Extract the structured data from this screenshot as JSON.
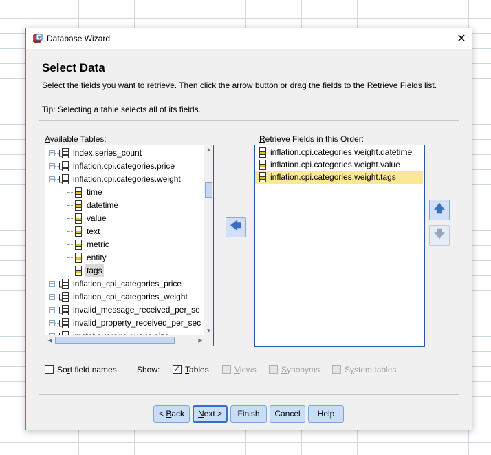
{
  "window": {
    "title": "Database Wizard",
    "close_glyph": "✕"
  },
  "heading": "Select Data",
  "description": "Select the fields you want to retrieve. Then click the arrow button or drag the fields to the Retrieve Fields list.",
  "tip": "Tip: Selecting a table selects all of its fields.",
  "available": {
    "label_pre": "",
    "label_ul": "A",
    "label_post": "vailable Tables:",
    "items": [
      {
        "label": "index.series_count",
        "expand": "+"
      },
      {
        "label": "inflation.cpi.categories.price",
        "expand": "+"
      },
      {
        "label": "inflation.cpi.categories.weight",
        "expand": "−"
      },
      {
        "label": "time"
      },
      {
        "label": "datetime"
      },
      {
        "label": "value"
      },
      {
        "label": "text"
      },
      {
        "label": "metric"
      },
      {
        "label": "entity"
      },
      {
        "label": "tags",
        "selected": true
      },
      {
        "label": "inflation_cpi_categories_price",
        "expand": "+"
      },
      {
        "label": "inflation_cpi_categories_weight",
        "expand": "+"
      },
      {
        "label": "invalid_message_received_per_se",
        "expand": "+"
      },
      {
        "label": "invalid_property_received_per_sec",
        "expand": "+"
      },
      {
        "label": "jmstat average queue size",
        "expand": "+"
      }
    ]
  },
  "retrieve": {
    "label_pre": "",
    "label_ul": "R",
    "label_post": "etrieve Fields in this Order:",
    "items": [
      {
        "label": "inflation.cpi.categories.weight.datetime"
      },
      {
        "label": "inflation.cpi.categories.weight.value"
      },
      {
        "label": "inflation.cpi.categories.weight.tags",
        "selected": true
      }
    ]
  },
  "arrows": {
    "add": "🡄",
    "up": "🡅",
    "down": "🡇"
  },
  "options": {
    "sort": {
      "pre": "So",
      "ul": "r",
      "post": "t field names",
      "checked": false
    },
    "show_label": "Show:",
    "tables": {
      "pre": "",
      "ul": "T",
      "post": "ables",
      "checked": true
    },
    "views": {
      "pre": "",
      "ul": "V",
      "post": "iews",
      "checked": false,
      "disabled": true
    },
    "synonyms": {
      "pre": "",
      "ul": "S",
      "post": "ynonyms",
      "checked": false,
      "disabled": true
    },
    "system_tables": {
      "pre": "S",
      "ul": "y",
      "post": "stem tables",
      "checked": false,
      "disabled": true
    }
  },
  "buttons": {
    "back": {
      "pre": "< ",
      "ul": "B",
      "post": "ack"
    },
    "next": {
      "pre": "",
      "ul": "N",
      "post": "ext >"
    },
    "finish": {
      "pre": "Finish",
      "ul": "",
      "post": ""
    },
    "cancel": {
      "pre": "Cancel",
      "ul": "",
      "post": ""
    },
    "help": {
      "pre": "Help",
      "ul": "",
      "post": ""
    }
  },
  "colors": {
    "dialog_border": "#4a7ec9",
    "list_border": "#2a56a6",
    "selected_field": "#fbe896",
    "button_face": "#c9ddf6",
    "arrow_blue": "#3b6fc0"
  }
}
